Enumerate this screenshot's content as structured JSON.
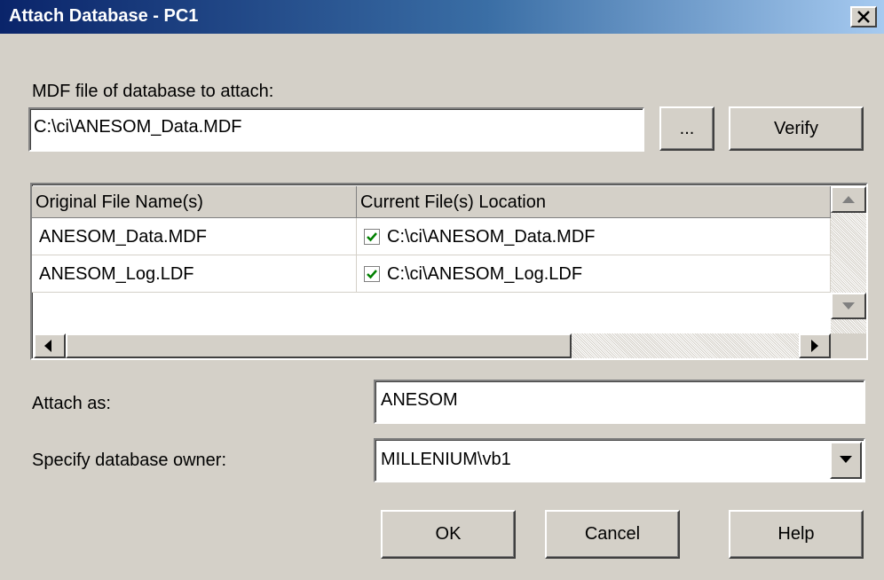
{
  "window": {
    "title": "Attach Database - PC1",
    "close_label": "✕"
  },
  "mdf": {
    "label": "MDF file of database to attach:",
    "value": "C:\\ci\\ANESOM_Data.MDF",
    "browse_label": "...",
    "verify_label": "Verify"
  },
  "files_table": {
    "columns": [
      "Original File Name(s)",
      "Current File(s) Location"
    ],
    "rows": [
      {
        "original": "ANESOM_Data.MDF",
        "checked": true,
        "location": "C:\\ci\\ANESOM_Data.MDF"
      },
      {
        "original": "ANESOM_Log.LDF",
        "checked": true,
        "location": "C:\\ci\\ANESOM_Log.LDF"
      }
    ]
  },
  "attach_as": {
    "label": "Attach as:",
    "value": "ANESOM"
  },
  "owner": {
    "label": "Specify database owner:",
    "value": "MILLENIUM\\vb1"
  },
  "buttons": {
    "ok": "OK",
    "cancel": "Cancel",
    "help": "Help"
  },
  "icons": {
    "close": "close-icon",
    "check": "check-icon",
    "scroll_up": "arrow-up-icon",
    "scroll_down": "arrow-down-icon",
    "scroll_left": "arrow-left-icon",
    "scroll_right": "arrow-right-icon",
    "dropdown": "chevron-down-icon"
  },
  "colors": {
    "titlebar_start": "#0a246a",
    "titlebar_end": "#a6caf0",
    "face": "#d4d0c8",
    "check": "#008000"
  }
}
